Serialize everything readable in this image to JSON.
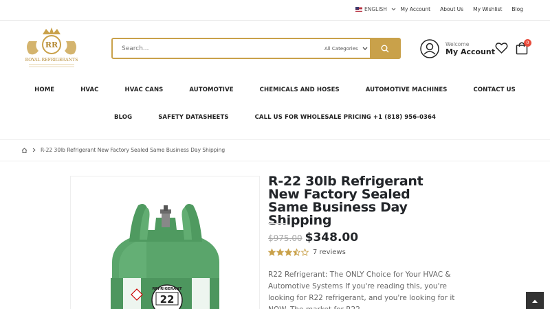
{
  "topbar": {
    "language": "ENGLISH",
    "links": [
      "My Account",
      "About Us",
      "My Wishlist",
      "Blog"
    ]
  },
  "logo": {
    "monogram": "RR",
    "name": "ROYAL REFRIGERANTS"
  },
  "search": {
    "placeholder": "Search...",
    "category": "All Categories"
  },
  "account": {
    "welcome": "Welcome",
    "label": "My Account"
  },
  "cart": {
    "count": "0"
  },
  "nav": {
    "row1": [
      "HOME",
      "HVAC",
      "HVAC CANS",
      "AUTOMOTIVE",
      "CHEMICALS AND HOSES",
      "AUTOMOTIVE MACHINES",
      "CONTACT US"
    ],
    "row2": [
      "BLOG",
      "SAFETY DATASHEETS",
      "CALL US FOR WHOLESALE PRICING +1 (818) 956-0364"
    ]
  },
  "breadcrumb": {
    "current": "R-22 30lb Refrigerant New Factory Sealed Same Business Day Shipping"
  },
  "product": {
    "title": "R-22 30lb Refrigerant New Factory Sealed Same Business Day Shipping",
    "old_price": "$975.00",
    "price": "$348.00",
    "rating": 3.5,
    "reviews": "7 reviews",
    "description": "R22 Refrigerant: The ONLY Choice for Your HVAC & Automotive Systems If you're reading this, you're looking for R22 refrigerant, and you're looking for it NOW. The market for R22",
    "tank_label": "22",
    "tank_brand": "REFRIGERANT"
  },
  "colors": {
    "accent": "#c9a14a",
    "star": "#c9a14a",
    "tank": "#5aa56b"
  }
}
